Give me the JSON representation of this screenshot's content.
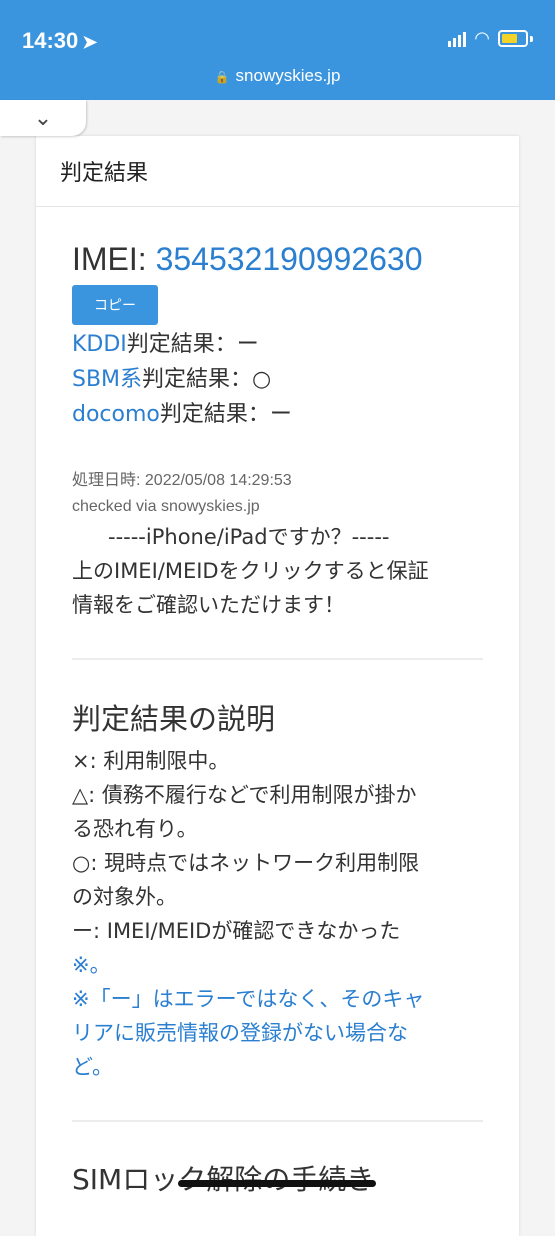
{
  "status_bar": {
    "time": "14:30",
    "location_icon": "location-arrow-icon",
    "url": "snowyskies.jp",
    "accent_color": "#3a95de"
  },
  "card": {
    "header": "判定結果",
    "imei_label": "IMEI: ",
    "imei_value": "354532190992630",
    "copy_button": "コピー",
    "results": [
      {
        "carrier": "KDDI",
        "suffix": "判定結果：ー"
      },
      {
        "carrier": "SBM系",
        "suffix": "判定結果：○"
      },
      {
        "carrier": "docomo",
        "suffix": "判定結果：ー"
      }
    ],
    "processed_at": "処理日時: 2022/05/08 14:29:53",
    "checked_via": "checked via snowyskies.jp",
    "iphone_line_1": "-----iPhone/iPadですか？-----",
    "iphone_line_2": "上のIMEI/MEIDをクリックすると保証",
    "iphone_line_3": "情報をご確認いただけます！",
    "legend_title": "判定結果の説明",
    "legend_lines": [
      "×: 利用制限中。",
      "△: 債務不履行などで利用制限が掛か",
      "る恐れ有り。",
      "○: 現時点ではネットワーク利用制限",
      "の対象外。",
      "ー: IMEI/MEIDが確認できなかった"
    ],
    "legend_note_mark": "※。",
    "legend_note": [
      "※「ー」はエラーではなく、そのキャ",
      "リアに販売情報の登録がない場合な",
      "ど。"
    ],
    "next_section_title": "SIMロック解除の手続き"
  }
}
